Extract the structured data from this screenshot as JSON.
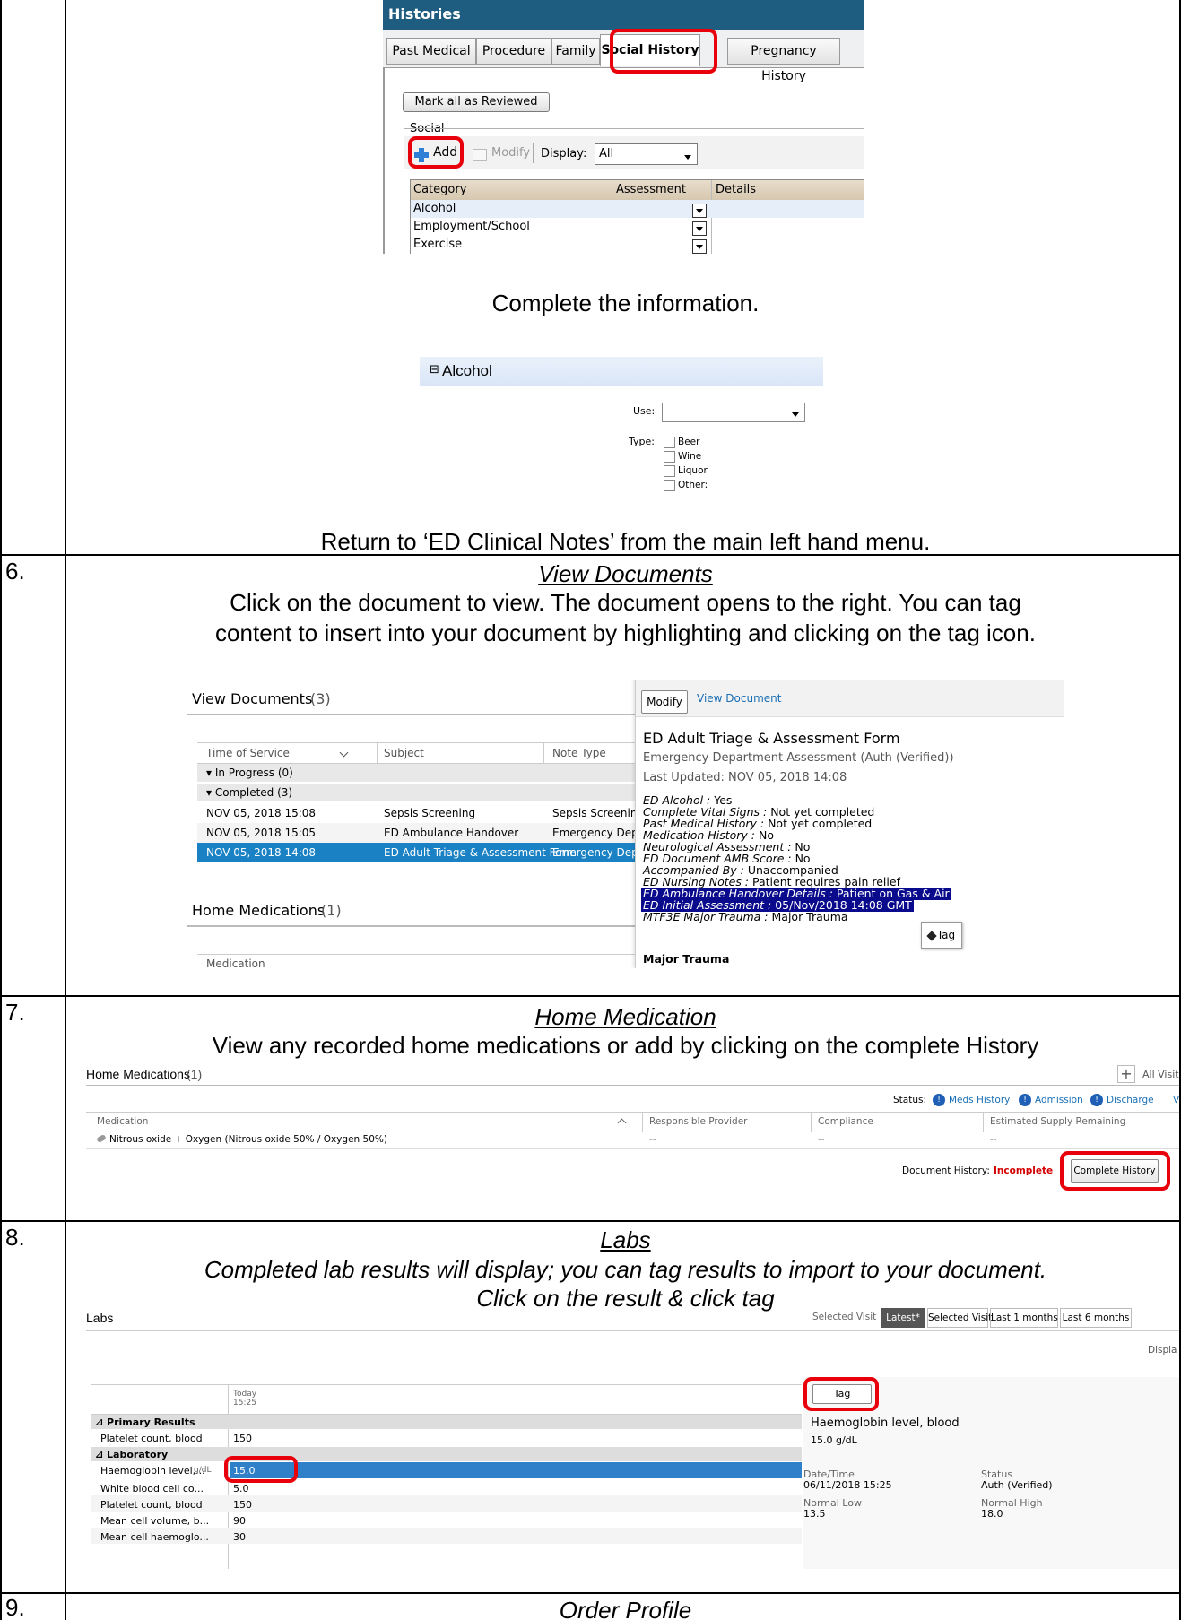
{
  "row5": {
    "histories": {
      "title": "Histories",
      "tabs": [
        "Past Medical",
        "Procedure",
        "Family",
        "Social History",
        "Pregnancy History"
      ],
      "mark_reviewed": "Mark all as Reviewed",
      "section": "Social",
      "add": "Add",
      "modify": "Modify",
      "display_label": "Display:",
      "display_value": "All",
      "columns": [
        "Category",
        "Assessment",
        "Details"
      ],
      "rows": [
        "Alcohol",
        "Employment/School",
        "Exercise"
      ]
    },
    "complete_text": "Complete the information.",
    "alcohol": {
      "header": "Alcohol",
      "use_label": "Use:",
      "type_label": "Type:",
      "options": [
        "Beer",
        "Wine",
        "Liquor",
        "Other:"
      ]
    },
    "return_text": "Return to ‘ED Clinical Notes’ from the main left hand menu."
  },
  "row6": {
    "num": "6.",
    "title": "View Documents",
    "desc1": "Click on the document to view. The document opens to the right. You can tag",
    "desc2": "content to insert into your document by highlighting and clicking on the tag icon.",
    "panel_title": "View Documents",
    "panel_count": "(3)",
    "columns": [
      "Time of Service",
      "Subject",
      "Note Type"
    ],
    "groups": [
      "▾ In Progress (0)",
      "▾ Completed (3)"
    ],
    "docs": [
      {
        "time": "NOV 05, 2018 15:08",
        "subject": "Sepsis Screening",
        "type": "Sepsis Screening Form"
      },
      {
        "time": "NOV 05, 2018 15:05",
        "subject": "ED Ambulance Handover",
        "type": "Emergency Department Hando"
      },
      {
        "time": "NOV 05, 2018 14:08",
        "subject": "ED Adult Triage & Assessment Form",
        "type": "Emergency Department Asse"
      }
    ],
    "home_med_title": "Home Medications",
    "home_med_count": "(1)",
    "medication_col": "Medication",
    "viewer": {
      "modify": "Modify",
      "link": "View Document",
      "doc_title": "ED Adult Triage & Assessment Form",
      "doc_sub": "Emergency Department Assessment (Auth (Verified))",
      "updated": "Last Updated: NOV 05, 2018 14:08",
      "lines": [
        {
          "k": "ED Alcohol :",
          "v": " Yes"
        },
        {
          "k": "Complete Vital Signs :",
          "v": "  Not yet completed"
        },
        {
          "k": "Past Medical History :",
          "v": "  Not yet completed"
        },
        {
          "k": "Medication History :",
          "v": "  No"
        },
        {
          "k": "Neurological Assessment :",
          "v": "  No"
        },
        {
          "k": "ED Document AMB Score :",
          "v": "  No"
        },
        {
          "k": "Accompanied By :",
          "v": "  Unaccompanied"
        },
        {
          "k": "ED Nursing Notes :",
          "v": "  Patient requires pain relief"
        },
        {
          "k": "ED Ambulance Handover Details :",
          "v": "  Patient on Gas & Air"
        },
        {
          "k": "ED Initial Assessment :",
          "v": "  05/Nov/2018 14:08 GMT"
        },
        {
          "k": "MTF3E Major Trauma :",
          "v": "  Major Trauma"
        }
      ],
      "major": "Major Trauma",
      "tag": "Tag"
    }
  },
  "row7": {
    "num": "7.",
    "title": "Home Medication",
    "desc": "View any recorded home medications or add by clicking on the complete History",
    "panel_title": "Home Medications",
    "panel_count": "(1)",
    "all_visits": "All Visit",
    "status_label": "Status:",
    "statuses": [
      "Meds History",
      "Admission",
      "Discharge",
      "V"
    ],
    "columns": [
      "Medication",
      "Responsible Provider",
      "Compliance",
      "Estimated Supply Remaining"
    ],
    "med": "Nitrous oxide + Oxygen (Nitrous oxide 50% / Oxygen 50%)",
    "dash": "--",
    "doc_history_label": "Document History:",
    "doc_history_value": "Incomplete",
    "complete_btn": "Complete History"
  },
  "row8": {
    "num": "8.",
    "title": "Labs",
    "desc1": "Completed lab results will display; you can tag results to import to your document.",
    "desc2": "Click on the result & click tag",
    "panel_title": "Labs",
    "filters": [
      "Selected Visit",
      "Latest*",
      "Selected Visit",
      "Last 1 months",
      "Last 6 months"
    ],
    "displa": "Displa",
    "col_today": "Today",
    "col_time": "15:25",
    "sections": [
      "⊿ Primary Results",
      "⊿ Laboratory"
    ],
    "results": [
      {
        "name": "Platelet count, blood",
        "unit": "",
        "value": "150"
      },
      {
        "name": "Haemoglobin level,...",
        "unit": "g/dL",
        "value": "15.0"
      },
      {
        "name": "White blood cell co...",
        "unit": "",
        "value": "5.0"
      },
      {
        "name": "Platelet count, blood",
        "unit": "",
        "value": "150"
      },
      {
        "name": "Mean cell volume, b...",
        "unit": "",
        "value": "90"
      },
      {
        "name": "Mean cell haemoglo...",
        "unit": "",
        "value": "30"
      }
    ],
    "detail": {
      "tag": "Tag",
      "name": "Haemoglobin level, blood",
      "value": "15.0 g/dL",
      "dt_label": "Date/Time",
      "dt": "06/11/2018 15:25",
      "status_label": "Status",
      "status": "Auth (Verified)",
      "low_label": "Normal Low",
      "low": "13.5",
      "high_label": "Normal High",
      "high": "18.0"
    }
  },
  "row9": {
    "num": "9.",
    "title": "Order Profile"
  }
}
